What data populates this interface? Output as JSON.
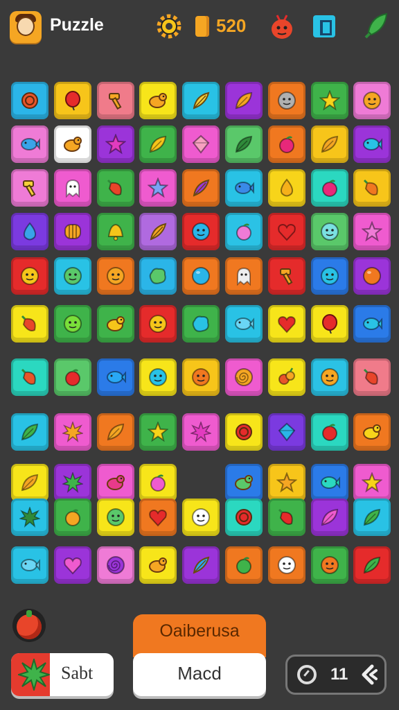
{
  "header": {
    "title": "Puzzle",
    "score": "520",
    "icons": [
      "avatar-icon",
      "gear-icon",
      "coin-icon",
      "bug-icon",
      "box-icon",
      "leaf-icon"
    ]
  },
  "board": {
    "rows": [
      [
        [
          "#2bb5e8",
          "ring",
          "#e8552a"
        ],
        [
          "#f7c51a",
          "balloon",
          "#e52b2b"
        ],
        [
          "#f07b8a",
          "hammer",
          "#f5a623"
        ],
        [
          "#f7e51a",
          "bird",
          "#f5a623"
        ],
        [
          "#29c2e5",
          "feather",
          "#f5d03a"
        ],
        [
          "#9b34d9",
          "leaf",
          "#f5a623"
        ],
        [
          "#f07820",
          "face",
          "#b0b0b0"
        ],
        [
          "#3fb34a",
          "star",
          "#f7d41a"
        ],
        [
          "#ef7bd6",
          "face",
          "#f5a623"
        ]
      ],
      [
        [
          "#ef7bd6",
          "fish",
          "#3aa3e8"
        ],
        [
          "#ffffff",
          "bird",
          "#f5a623"
        ],
        [
          "#9b34d9",
          "star",
          "#e23bbf"
        ],
        [
          "#3fb34a",
          "leaf",
          "#f5c51a"
        ],
        [
          "#ef5bcf",
          "gem",
          "#f7a0c0"
        ],
        [
          "#5ac86a",
          "leaf",
          "#2f8a3a"
        ],
        [
          "#f07820",
          "apple",
          "#e8287a"
        ],
        [
          "#f7c51a",
          "leaf",
          "#f5a623"
        ],
        [
          "#9b34d9",
          "fish",
          "#29c2e5"
        ]
      ],
      [
        [
          "#ef7bd6",
          "hammer",
          "#f5d03a"
        ],
        [
          "#ef5bcf",
          "ghost",
          "#ffffff"
        ],
        [
          "#3fb34a",
          "pepper",
          "#e8452a"
        ],
        [
          "#ef5bcf",
          "star",
          "#7aa3f5"
        ],
        [
          "#f07820",
          "feather",
          "#9b34d9"
        ],
        [
          "#29c2e5",
          "fish",
          "#3a8ae8"
        ],
        [
          "#f7d41a",
          "drop",
          "#f5b01a"
        ],
        [
          "#2bd8c0",
          "apple",
          "#e8287a"
        ],
        [
          "#f7c51a",
          "pepper",
          "#f07820"
        ]
      ],
      [
        [
          "#7b3ae0",
          "drop",
          "#3aa3e8"
        ],
        [
          "#9b34d9",
          "stripes",
          "#f5a623"
        ],
        [
          "#3fb34a",
          "bell",
          "#f5c51a"
        ],
        [
          "#b06ae0",
          "feather",
          "#f5a623"
        ],
        [
          "#e52b2b",
          "face",
          "#2bb5e8"
        ],
        [
          "#2bc2e5",
          "apple",
          "#ef7bd6"
        ],
        [
          "#e52b2b",
          "heart",
          "#e52b2b"
        ],
        [
          "#5ac86a",
          "face",
          "#7ae0e0"
        ],
        [
          "#ef5bcf",
          "star",
          "#ef7bd6"
        ]
      ],
      [
        [
          "#e52b2b",
          "face",
          "#f5c51a"
        ],
        [
          "#29c2e5",
          "face",
          "#5ac86a"
        ],
        [
          "#f07820",
          "face",
          "#f5a623"
        ],
        [
          "#2bb5e8",
          "blob",
          "#5ac86a"
        ],
        [
          "#f07820",
          "ball",
          "#2bb5e8"
        ],
        [
          "#f07820",
          "ghost",
          "#eeeeee"
        ],
        [
          "#e52b2b",
          "hammer",
          "#f5a623"
        ],
        [
          "#2b7be8",
          "face",
          "#29c2e5"
        ],
        [
          "#9b34d9",
          "ball",
          "#f07820"
        ]
      ],
      [
        [
          "#f7e51a",
          "pepper",
          "#e8452a"
        ],
        [
          "#3fb34a",
          "face",
          "#7adf3a"
        ],
        [
          "#3fb34a",
          "bird",
          "#f5c51a"
        ],
        [
          "#e52b2b",
          "face",
          "#f5c51a"
        ],
        [
          "#3fb34a",
          "blob",
          "#29c2e5"
        ],
        [
          "#29c2e5",
          "fish",
          "#6ad6f5"
        ],
        [
          "#f7e51a",
          "heart",
          "#e52b2b"
        ],
        [
          "#f7e51a",
          "balloon",
          "#e52b2b"
        ],
        [
          "#2b7be8",
          "fish",
          "#29c2e5"
        ]
      ],
      [
        [
          "#2bd8c0",
          "pepper",
          "#e8552a"
        ],
        [
          "#5ac86a",
          "apple",
          "#e52b2b"
        ],
        [
          "#2b7be8",
          "fish",
          "#29a8f5"
        ],
        [
          "#f7e51a",
          "face",
          "#29c2e5"
        ],
        [
          "#f7c51a",
          "face",
          "#f07820"
        ],
        [
          "#ef5bcf",
          "spiral",
          "#f5a623"
        ],
        [
          "#f7e51a",
          "veggies",
          "#e8552a"
        ],
        [
          "#2bc2e5",
          "face",
          "#f5a623"
        ],
        [
          "#f07b8a",
          "pepper",
          "#e8452a"
        ]
      ],
      [
        [
          "#29c2e5",
          "leaf",
          "#3fb34a"
        ],
        [
          "#ef5bcf",
          "burst",
          "#f5a623"
        ],
        [
          "#f07820",
          "leaf",
          "#f5a623"
        ],
        [
          "#3fb34a",
          "star",
          "#f7d41a"
        ],
        [
          "#ef5bcf",
          "burst",
          "#e23bbf"
        ],
        [
          "#f7e51a",
          "ring",
          "#e52b2b"
        ],
        [
          "#7b3ae0",
          "gem",
          "#2bb5e8"
        ],
        [
          "#2bd8c0",
          "apple",
          "#e52b2b"
        ],
        [
          "#f07820",
          "bird",
          "#f7d41a"
        ]
      ],
      [
        [
          "#f7e51a",
          "leaf",
          "#f5a623"
        ],
        [
          "#9b34d9",
          "burst",
          "#3fb34a"
        ],
        [
          "#ef5bcf",
          "bird",
          "#e83a8a"
        ],
        [
          "#f7e51a",
          "apple",
          "#ef5bcf"
        ],
        null,
        [
          "#2b7be8",
          "bird",
          "#5ac86a"
        ],
        [
          "#f7c51a",
          "star",
          "#f5a623"
        ],
        [
          "#2b7be8",
          "fish",
          "#2bd8c0"
        ],
        [
          "#ef5bcf",
          "star",
          "#f7d41a"
        ]
      ],
      [
        [
          "#29c2e5",
          "burst",
          "#2f8a3a"
        ],
        [
          "#3fb34a",
          "apple",
          "#f5a623"
        ],
        [
          "#f7e51a",
          "face",
          "#5ac86a"
        ],
        [
          "#f07820",
          "heart",
          "#e52b2b"
        ],
        [
          "#f7e51a",
          "face",
          "#ffffff"
        ],
        [
          "#2bd8c0",
          "ring",
          "#e52b2b"
        ],
        [
          "#3fb34a",
          "pepper",
          "#e52b2b"
        ],
        [
          "#9b34d9",
          "leaf",
          "#ef5bcf"
        ],
        [
          "#29c2e5",
          "leaf",
          "#3fb34a"
        ]
      ],
      [
        [
          "#29c2e5",
          "fish",
          "#6ad6f5"
        ],
        [
          "#9b34d9",
          "heart",
          "#ef5bcf"
        ],
        [
          "#ef7bd6",
          "spiral",
          "#9b34d9"
        ],
        [
          "#f7e51a",
          "bird",
          "#f5a623"
        ],
        [
          "#9b34d9",
          "feather",
          "#29a8f5"
        ],
        [
          "#f07820",
          "apple",
          "#3fb34a"
        ],
        [
          "#f07820",
          "face",
          "#ffffff"
        ],
        [
          "#3fb34a",
          "face",
          "#f07820"
        ],
        [
          "#e52b2b",
          "leaf",
          "#3fb34a"
        ]
      ]
    ]
  },
  "footer": {
    "start_label": "Sabt",
    "banner_label": "Oaiberusa",
    "mode_label": "Macd",
    "counter": "11",
    "icons": [
      "bomb-icon",
      "burst-icon",
      "timer-icon",
      "back-icon"
    ]
  }
}
